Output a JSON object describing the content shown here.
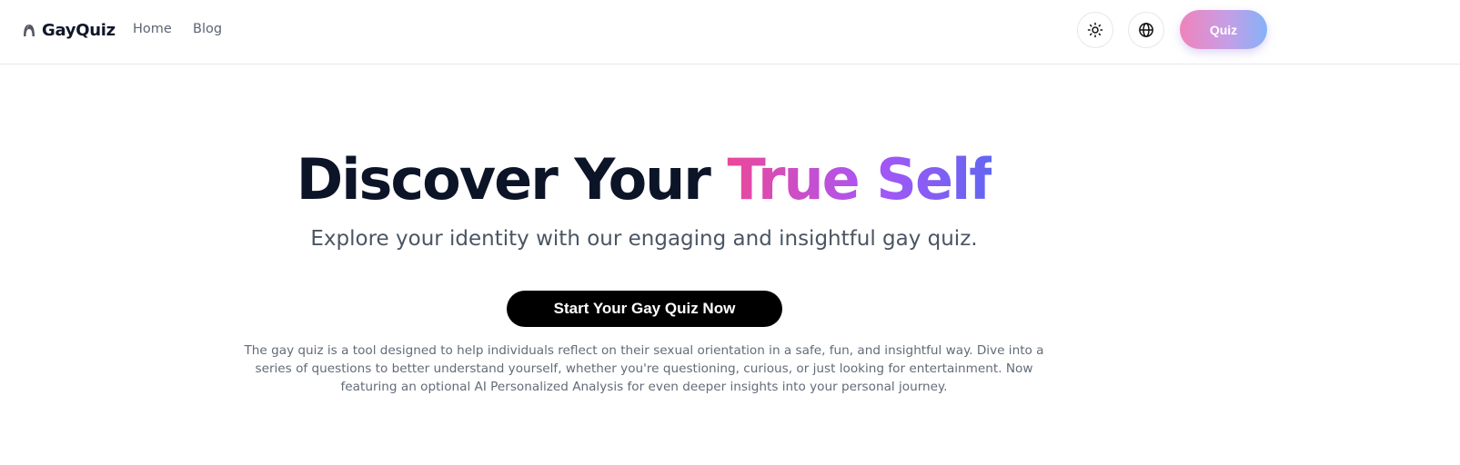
{
  "nav": {
    "brand": "GayQuiz",
    "links": [
      "Home",
      "Blog"
    ],
    "quiz_button": "Quiz",
    "icons": [
      "sun-icon",
      "globe-icon"
    ]
  },
  "hero": {
    "title_plain": "Discover Your ",
    "title_highlight": "True Self",
    "subtitle": "Explore your identity with our engaging and insightful gay quiz.",
    "cta": "Start Your Gay Quiz Now",
    "description": "The gay quiz is a tool designed to help individuals reflect on their sexual orientation in a safe, fun, and insightful way. Dive into a series of questions to better understand yourself, whether you're questioning, curious, or just looking for entertainment. Now featuring an optional AI Personalized Analysis for even deeper insights into your personal journey."
  },
  "colors": {
    "title_dark": "#0c1428",
    "gradient": [
      "#ec4899",
      "#a855f7",
      "#6366f1"
    ],
    "quiz_button_gradient": [
      "#f083bb",
      "#c59ee6",
      "#85b2f8"
    ],
    "cta_background": "#000000"
  }
}
